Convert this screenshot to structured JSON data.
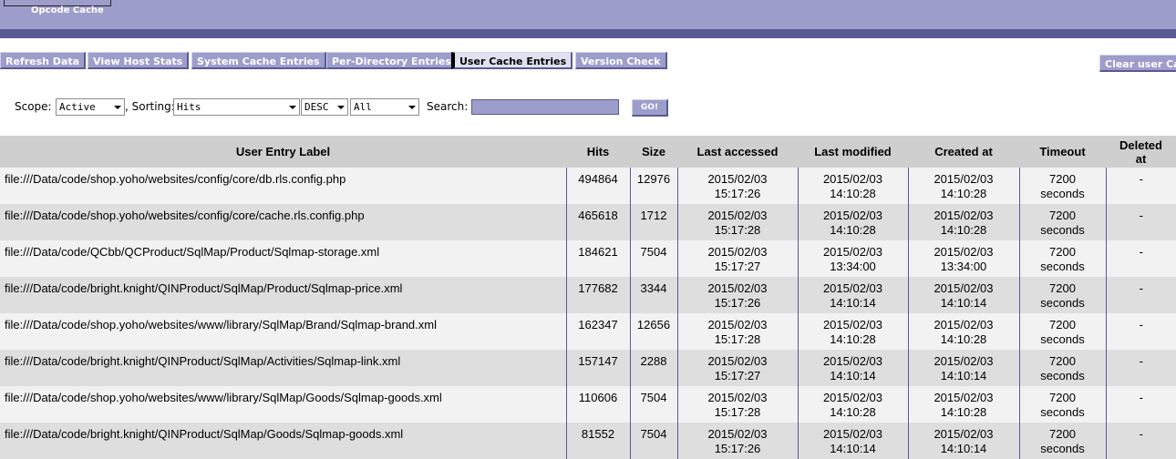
{
  "header": {
    "logo_text": "Opcode Cache"
  },
  "nav": {
    "refresh": "Refresh Data",
    "host_stats": "View Host Stats",
    "system_cache": "System Cache Entries",
    "per_directory": "Per-Directory Entries",
    "user_cache": "User Cache Entries",
    "version_check": "Version Check",
    "clear_user": "Clear user Ca"
  },
  "controls": {
    "scope_label": "Scope:",
    "scope_value": "Active",
    "sorting_label": ", Sorting:",
    "sort_value": "Hits",
    "order_value": "DESC",
    "count_value": "All",
    "search_label": "Search:",
    "search_value": "",
    "go_label": "GO!"
  },
  "table": {
    "headers": {
      "label": "User Entry Label",
      "hits": "Hits",
      "size": "Size",
      "last_accessed": "Last accessed",
      "last_modified": "Last modified",
      "created": "Created at",
      "timeout": "Timeout",
      "deleted_1": "Deleted",
      "deleted_2": "at"
    },
    "rows": [
      {
        "label": "file:///Data/code/shop.yoho/websites/config/core/db.rls.config.php",
        "hits": "494864",
        "size": "12976",
        "acc_d": "2015/02/03",
        "acc_t": "15:17:26",
        "mod_d": "2015/02/03",
        "mod_t": "14:10:28",
        "cre_d": "2015/02/03",
        "cre_t": "14:10:28",
        "to_v": "7200",
        "to_u": "seconds",
        "del": "-"
      },
      {
        "label": "file:///Data/code/shop.yoho/websites/config/core/cache.rls.config.php",
        "hits": "465618",
        "size": "1712",
        "acc_d": "2015/02/03",
        "acc_t": "15:17:28",
        "mod_d": "2015/02/03",
        "mod_t": "14:10:28",
        "cre_d": "2015/02/03",
        "cre_t": "14:10:28",
        "to_v": "7200",
        "to_u": "seconds",
        "del": "-"
      },
      {
        "label": "file:///Data/code/QCbb/QCProduct/SqlMap/Product/Sqlmap-storage.xml",
        "hits": "184621",
        "size": "7504",
        "acc_d": "2015/02/03",
        "acc_t": "15:17:27",
        "mod_d": "2015/02/03",
        "mod_t": "13:34:00",
        "cre_d": "2015/02/03",
        "cre_t": "13:34:00",
        "to_v": "7200",
        "to_u": "seconds",
        "del": "-"
      },
      {
        "label": "file:///Data/code/bright.knight/QINProduct/SqlMap/Product/Sqlmap-price.xml",
        "hits": "177682",
        "size": "3344",
        "acc_d": "2015/02/03",
        "acc_t": "15:17:26",
        "mod_d": "2015/02/03",
        "mod_t": "14:10:14",
        "cre_d": "2015/02/03",
        "cre_t": "14:10:14",
        "to_v": "7200",
        "to_u": "seconds",
        "del": "-"
      },
      {
        "label": "file:///Data/code/shop.yoho/websites/www/library/SqlMap/Brand/Sqlmap-brand.xml",
        "hits": "162347",
        "size": "12656",
        "acc_d": "2015/02/03",
        "acc_t": "15:17:28",
        "mod_d": "2015/02/03",
        "mod_t": "14:10:28",
        "cre_d": "2015/02/03",
        "cre_t": "14:10:28",
        "to_v": "7200",
        "to_u": "seconds",
        "del": "-"
      },
      {
        "label": "file:///Data/code/bright.knight/QINProduct/SqlMap/Activities/Sqlmap-link.xml",
        "hits": "157147",
        "size": "2288",
        "acc_d": "2015/02/03",
        "acc_t": "15:17:27",
        "mod_d": "2015/02/03",
        "mod_t": "14:10:14",
        "cre_d": "2015/02/03",
        "cre_t": "14:10:14",
        "to_v": "7200",
        "to_u": "seconds",
        "del": "-"
      },
      {
        "label": "file:///Data/code/shop.yoho/websites/www/library/SqlMap/Goods/Sqlmap-goods.xml",
        "hits": "110606",
        "size": "7504",
        "acc_d": "2015/02/03",
        "acc_t": "15:17:28",
        "mod_d": "2015/02/03",
        "mod_t": "14:10:28",
        "cre_d": "2015/02/03",
        "cre_t": "14:10:28",
        "to_v": "7200",
        "to_u": "seconds",
        "del": "-"
      },
      {
        "label": "file:///Data/code/bright.knight/QINProduct/SqlMap/Goods/Sqlmap-goods.xml",
        "hits": "81552",
        "size": "7504",
        "acc_d": "2015/02/03",
        "acc_t": "15:17:26",
        "mod_d": "2015/02/03",
        "mod_t": "14:10:14",
        "cre_d": "2015/02/03",
        "cre_t": "14:10:14",
        "to_v": "7200",
        "to_u": "seconds",
        "del": "-"
      }
    ]
  }
}
